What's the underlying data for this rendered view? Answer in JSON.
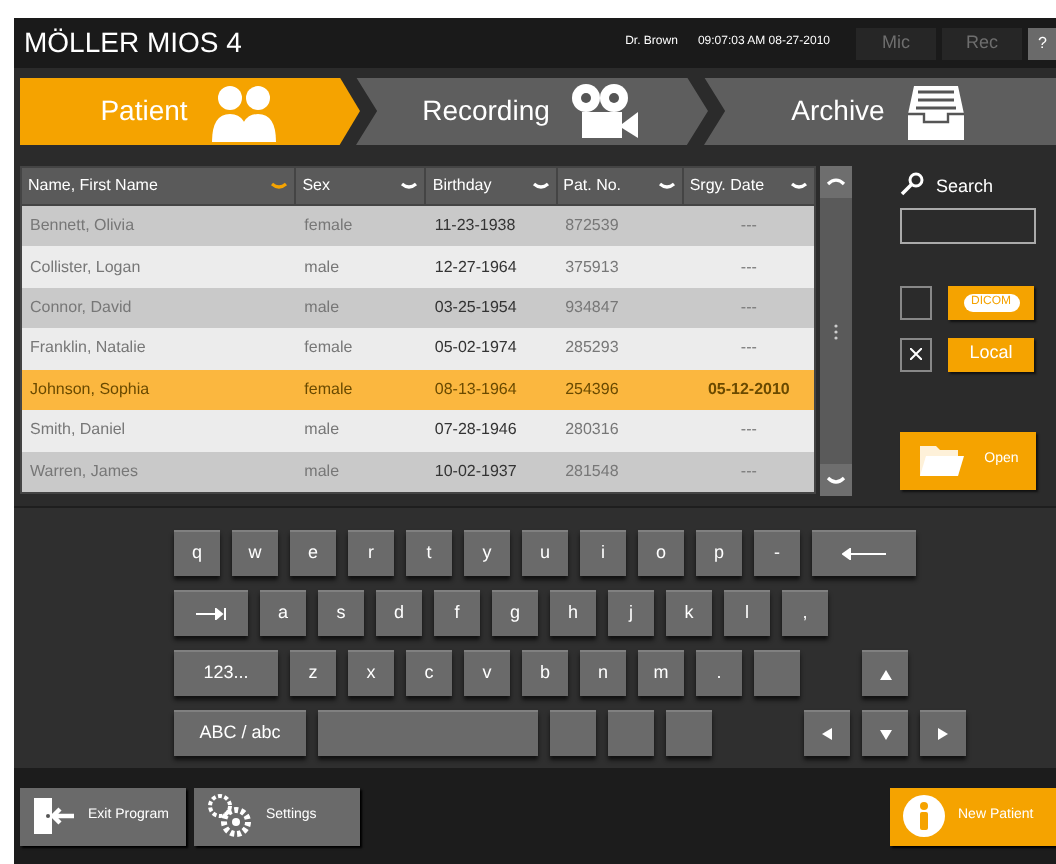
{
  "header": {
    "title": "MÖLLER MIOS 4",
    "user": "Dr. Brown",
    "datetime": "09:07:03 AM 08-27-2010",
    "buttons": [
      {
        "label": "Mic",
        "disabled": true
      },
      {
        "label": "Rec",
        "disabled": true
      },
      {
        "label": "?",
        "disabled": false
      }
    ]
  },
  "tabs": [
    {
      "label": "Patient",
      "selected": true,
      "kind": "people"
    },
    {
      "label": "Recording",
      "selected": false,
      "kind": "camera"
    },
    {
      "label": "Archive",
      "selected": false,
      "kind": "tray"
    }
  ],
  "table": {
    "columns": [
      {
        "label": "Name, First Name",
        "sorted": true
      },
      {
        "label": "Sex",
        "sorted": false
      },
      {
        "label": "Birthday",
        "sorted": false
      },
      {
        "label": "Pat. No.",
        "sorted": false
      },
      {
        "label": "Srgy. Date",
        "sorted": false
      }
    ],
    "rows": [
      {
        "cells": [
          "Bennett, Olivia",
          "female",
          "11-23-1938",
          "872539",
          "---"
        ],
        "selected": false
      },
      {
        "cells": [
          "Collister, Logan",
          "male",
          "12-27-1964",
          "375913",
          "---"
        ],
        "selected": false
      },
      {
        "cells": [
          "Connor, David",
          "male",
          "03-25-1954",
          "934847",
          "---"
        ],
        "selected": false
      },
      {
        "cells": [
          "Franklin, Natalie",
          "female",
          "05-02-1974",
          "285293",
          "---"
        ],
        "selected": false
      },
      {
        "cells": [
          "Johnson, Sophia",
          "female",
          "08-13-1964",
          "254396",
          "05-12-2010"
        ],
        "selected": true
      },
      {
        "cells": [
          "Smith, Daniel",
          "male",
          "07-28-1946",
          "280316",
          "---"
        ],
        "selected": false
      },
      {
        "cells": [
          "Warren, James",
          "male",
          "10-02-1937",
          "281548",
          "---"
        ],
        "selected": false
      }
    ]
  },
  "search": {
    "label": "Search"
  },
  "sources": [
    {
      "label": "DICOM",
      "checked": false,
      "kind": "pill"
    },
    {
      "label": "Local",
      "checked": true,
      "kind": "plain"
    }
  ],
  "open_button": {
    "label": "Open"
  },
  "keyboard": [
    [
      {
        "kind": "char",
        "label": "q"
      },
      {
        "kind": "char",
        "label": "w"
      },
      {
        "kind": "char",
        "label": "e"
      },
      {
        "kind": "char",
        "label": "r"
      },
      {
        "kind": "char",
        "label": "t"
      },
      {
        "kind": "char",
        "label": "y"
      },
      {
        "kind": "char",
        "label": "u"
      },
      {
        "kind": "char",
        "label": "i"
      },
      {
        "kind": "char",
        "label": "o"
      },
      {
        "kind": "char",
        "label": "p"
      },
      {
        "kind": "char",
        "label": "-"
      },
      {
        "kind": "backspace"
      }
    ],
    [
      {
        "kind": "tab"
      },
      {
        "kind": "char",
        "label": "a"
      },
      {
        "kind": "char",
        "label": "s"
      },
      {
        "kind": "char",
        "label": "d"
      },
      {
        "kind": "char",
        "label": "f"
      },
      {
        "kind": "char",
        "label": "g"
      },
      {
        "kind": "char",
        "label": "h"
      },
      {
        "kind": "char",
        "label": "j"
      },
      {
        "kind": "char",
        "label": "k"
      },
      {
        "kind": "char",
        "label": "l"
      },
      {
        "kind": "char",
        "label": ","
      }
    ],
    [
      {
        "kind": "wide",
        "label": "123..."
      },
      {
        "kind": "char",
        "label": "z"
      },
      {
        "kind": "char",
        "label": "x"
      },
      {
        "kind": "char",
        "label": "c"
      },
      {
        "kind": "char",
        "label": "v"
      },
      {
        "kind": "char",
        "label": "b"
      },
      {
        "kind": "char",
        "label": "n"
      },
      {
        "kind": "char",
        "label": "m"
      },
      {
        "kind": "char",
        "label": "."
      },
      {
        "kind": "blank"
      },
      {
        "kind": "up"
      }
    ],
    [
      {
        "kind": "wider",
        "label": "ABC / abc"
      },
      {
        "kind": "space"
      },
      {
        "kind": "blank"
      },
      {
        "kind": "blank"
      },
      {
        "kind": "blank"
      },
      {
        "kind": "left"
      },
      {
        "kind": "down"
      },
      {
        "kind": "right"
      }
    ]
  ],
  "footer": [
    {
      "label": "Exit Program",
      "kind": "exit"
    },
    {
      "label": "Settings",
      "kind": "settings"
    },
    {
      "label": "New Patient",
      "kind": "new"
    }
  ]
}
